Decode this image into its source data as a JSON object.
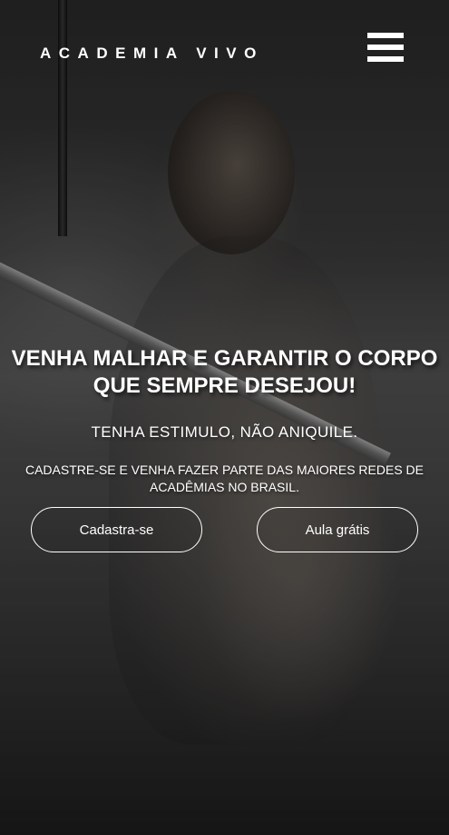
{
  "header": {
    "brand": "ACADEMIA VIVO",
    "menu_icon": "hamburger-menu-icon"
  },
  "hero": {
    "headline": "VENHA MALHAR E GARANTIR O CORPO QUE SEMPRE DESEJOU!",
    "tagline": "TENHA ESTIMULO, NÃO ANIQUILE.",
    "subtext": "CADASTRE-SE E VENHA FAZER PARTE DAS MAIORES REDES DE ACADÊMIAS NO BRASIL.",
    "buttons": {
      "signup_label": "Cadastra-se",
      "free_class_label": "Aula grátis"
    }
  },
  "colors": {
    "text": "#ffffff",
    "overlay": "#000000"
  }
}
